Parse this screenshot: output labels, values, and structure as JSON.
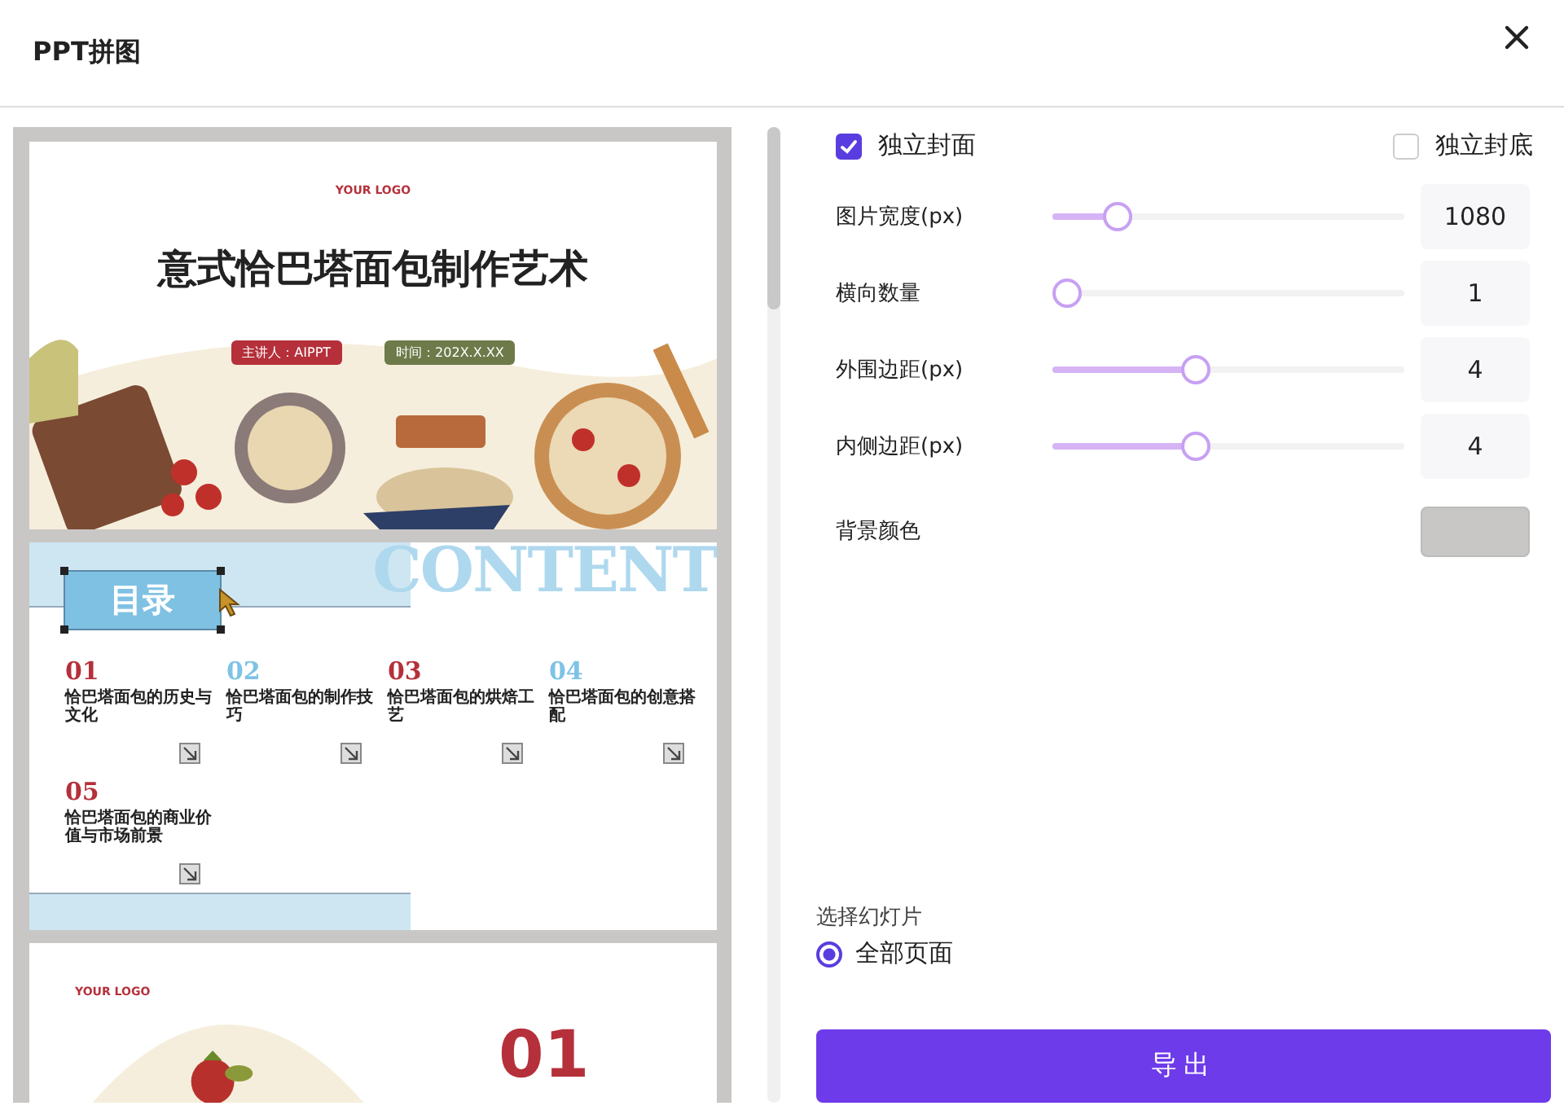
{
  "dialog": {
    "title": "PPT拼图"
  },
  "preview": {
    "slides": [
      {
        "kind": "cover",
        "logo": "YOUR LOGO",
        "title": "意式恰巴塔面包制作艺术",
        "presenter": "主讲人：AIPPT",
        "date": "时间：202X.X.XX"
      },
      {
        "kind": "contents",
        "heading": "目录",
        "watermark": "CONTENT",
        "items": [
          {
            "number": "01",
            "text": "恰巴塔面包的历史与文化",
            "color": "#b5303a"
          },
          {
            "number": "02",
            "text": "恰巴塔面包的制作技巧",
            "color": "#7ec3e6"
          },
          {
            "number": "03",
            "text": "恰巴塔面包的烘焙工艺",
            "color": "#b5303a"
          },
          {
            "number": "04",
            "text": "恰巴塔面包的创意搭配",
            "color": "#7ec3e6"
          },
          {
            "number": "05",
            "text": "恰巴塔面包的商业价值与市场前景",
            "color": "#b5303a"
          }
        ]
      },
      {
        "kind": "section",
        "logo": "YOUR LOGO",
        "number": "01"
      }
    ]
  },
  "options": {
    "checkboxes": [
      {
        "label": "独立封面",
        "checked": true
      },
      {
        "label": "独立封底",
        "checked": false
      }
    ],
    "sliders": [
      {
        "label": "图片宽度(px)",
        "level": 0.155,
        "value": "1080"
      },
      {
        "label": "横向数量",
        "level": 0,
        "value": "1"
      },
      {
        "label": "外围边距(px)",
        "level": 0.4,
        "value": "4"
      },
      {
        "label": "内侧边距(px)",
        "level": 0.4,
        "value": "4"
      }
    ],
    "background": {
      "label": "背景颜色",
      "color": "#c8c7c5"
    }
  },
  "slide_select": {
    "label": "选择幻灯片",
    "options": [
      {
        "label": "全部页面",
        "selected": true
      }
    ]
  },
  "export_button": "导出"
}
